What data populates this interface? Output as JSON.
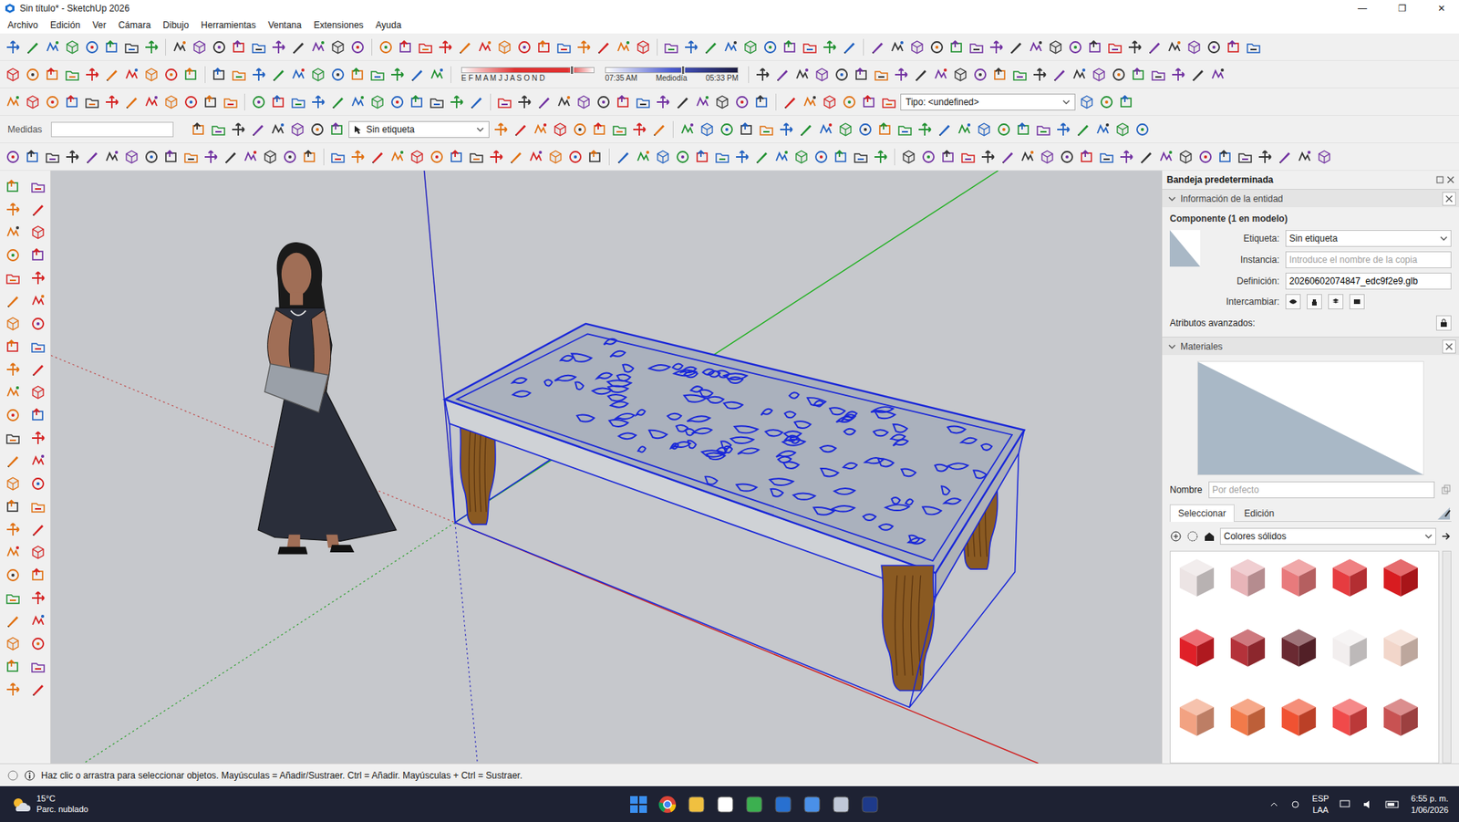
{
  "window": {
    "title": "Sin título* - SketchUp 2026",
    "controls": [
      "—",
      "❐",
      "✕"
    ]
  },
  "menu": [
    "Archivo",
    "Edición",
    "Ver",
    "Cámara",
    "Dibujo",
    "Herramientas",
    "Ventana",
    "Extensiones",
    "Ayuda"
  ],
  "toolbar": {
    "measurements_label": "Medidas",
    "measurements_value": "",
    "tag": "Sin etiqueta",
    "type": "Tipo: <undefined>",
    "shadow_months": "E F M A M J J A S O N D",
    "month_level": 0.84,
    "time_level": 0.59,
    "shadow_times": [
      "07:35 AM",
      "Mediodía",
      "05:33 PM"
    ]
  },
  "tray": {
    "title": "Bandeja predeterminada",
    "entity_section": {
      "title": "Información de la entidad",
      "expanded": true
    },
    "entity_kind": "Componente (1 en modelo)",
    "fields": [
      {
        "label": "Etiqueta:",
        "kind": "select",
        "value": "Sin etiqueta",
        "placeholder": ""
      },
      {
        "label": "Instancia:",
        "kind": "input",
        "value": "",
        "placeholder": "Introduce el nombre de la copia"
      },
      {
        "label": "Definición:",
        "kind": "input",
        "value": "20260602074847_edc9f2e9.glb",
        "placeholder": ""
      }
    ],
    "swap_label": "Intercambiar:",
    "advanced_label": "Atributos avanzados:",
    "materials_section": {
      "title": "Materiales",
      "expanded": true
    },
    "name_label": "Nombre",
    "name_placeholder": "Por defecto",
    "tabs": [
      {
        "label": "Seleccionar",
        "selected": true
      },
      {
        "label": "Edición",
        "selected": false
      }
    ],
    "library": "Colores sólidos",
    "swatches": [
      {
        "color": "#ece4e4"
      },
      {
        "color": "#e8b4b8"
      },
      {
        "color": "#e87a7c"
      },
      {
        "color": "#e63c40"
      },
      {
        "color": "#d81c20"
      },
      {
        "color": "#e02028"
      },
      {
        "color": "#b4323a"
      },
      {
        "color": "#6a2a32"
      },
      {
        "color": "#f2eeee"
      },
      {
        "color": "#f2d6ca"
      },
      {
        "color": "#f2a282"
      },
      {
        "color": "#f27a4a"
      },
      {
        "color": "#f05232"
      },
      {
        "color": "#f04a4a"
      },
      {
        "color": "#c85252"
      }
    ]
  },
  "status_bar": {
    "text": "Haz clic o arrastra para seleccionar objetos. Mayúsculas = Añadir/Sustraer. Ctrl = Añadir. Mayúsculas + Ctrl = Sustraer."
  },
  "taskbar": {
    "temperature": "15°C",
    "weather": "Parc. nublado",
    "language": [
      "ESP",
      "LAA"
    ],
    "time": "6:55 p. m.",
    "date": "1/06/2026"
  }
}
